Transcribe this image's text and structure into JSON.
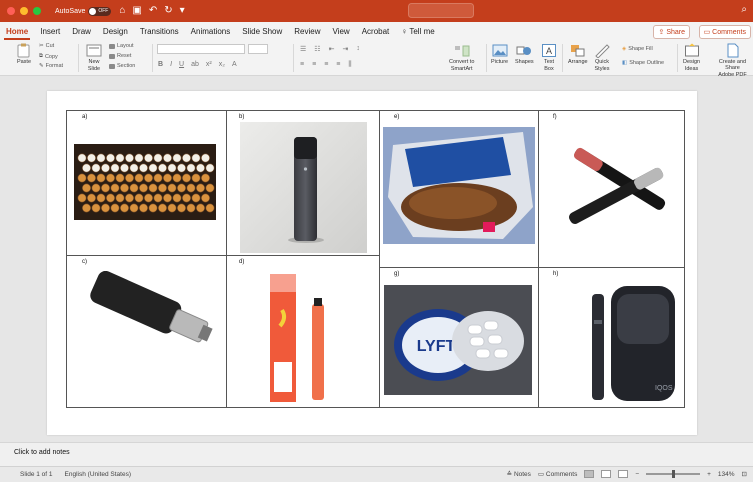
{
  "titlebar": {
    "autosave_label": "AutoSave",
    "autosave_state": "OFF",
    "colors": {
      "bar": "#c43e1c",
      "close": "#ff5f57",
      "min": "#febc2e",
      "max": "#28c840"
    }
  },
  "tabs": [
    "Home",
    "Insert",
    "Draw",
    "Design",
    "Transitions",
    "Animations",
    "Slide Show",
    "Review",
    "View",
    "Acrobat",
    "Tell me"
  ],
  "active_tab": "Home",
  "share_label": "Share",
  "comments_label": "Comments",
  "ribbon": {
    "paste": "Paste",
    "cut": "Cut",
    "copy": "Copy",
    "format": "Format",
    "new_slide_1": "New",
    "new_slide_2": "Slide",
    "layout": "Layout",
    "reset": "Reset",
    "section": "Section",
    "convert_1": "Convert to",
    "convert_2": "SmartArt",
    "picture": "Picture",
    "shapes": "Shapes",
    "text_1": "Text",
    "text_2": "Box",
    "arrange": "Arrange",
    "quick_1": "Quick",
    "quick_2": "Styles",
    "shape_fill": "Shape Fill",
    "shape_outline": "Shape Outline",
    "design_1": "Design",
    "design_2": "Ideas",
    "create_1": "Create and Share",
    "create_2": "Adobe PDF"
  },
  "slide": {
    "cells": [
      {
        "label": "a)",
        "image": "cigarettes"
      },
      {
        "label": "b)",
        "image": "pod-vape-device"
      },
      {
        "label": "e)",
        "image": "loose-tobacco-pouch"
      },
      {
        "label": "f)",
        "image": "vape-pens"
      },
      {
        "label": "c)",
        "image": "box-mod-vaporizer"
      },
      {
        "label": "d)",
        "image": "disposable-vape-with-box"
      },
      {
        "label": "g)",
        "image": "nicotine-pouches-tin"
      },
      {
        "label": "h)",
        "image": "heated-tobacco-device"
      }
    ],
    "brand_text": {
      "g": "LYFT",
      "h": "IQOS"
    }
  },
  "notes_placeholder": "Click to add notes",
  "status": {
    "slide": "Slide 1 of 1",
    "language": "English (United States)",
    "notes": "Notes",
    "comments": "Comments",
    "zoom_percent": "134%",
    "zoom_level": 0.5
  }
}
